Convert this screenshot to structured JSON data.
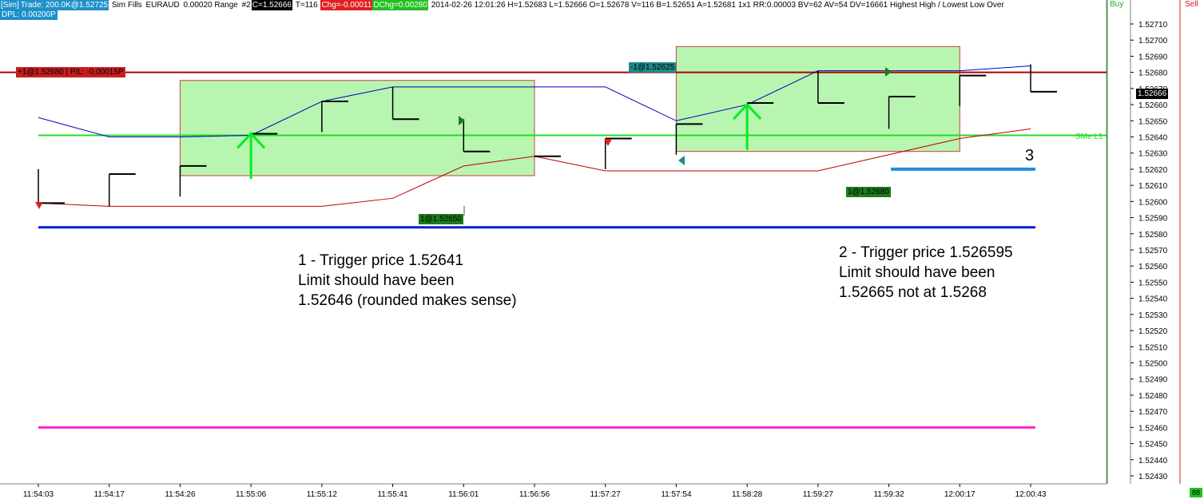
{
  "header": {
    "sim": "[Sim]",
    "trade": "Trade: 200.0K@1.52725",
    "fills": "Sim Fills",
    "symbol": "EURAUD",
    "range": "0.00020 Range",
    "num": "#2",
    "close": "C=1.52666",
    "ticks": "T=116",
    "chg": "Chg=-0.00011",
    "dchg": "DChg=0.00280",
    "stats": "2014-02-26 12:01:26 H=1.52683 L=1.52666 O=1.52678 V=116 B=1.52651 A=1.52681 1x1 RR:0.00003 BV=62 AV=54 DV=16661 Highest High / Lowest Low Over",
    "dpl": "DPL: 0.00200P"
  },
  "panels": {
    "buy": "Buy",
    "sell": "Sell",
    "corner": "88"
  },
  "colors": {
    "bars": "#000000",
    "upper_band": "#0000c0",
    "lower_band": "#c00000",
    "position_line": "#b00000",
    "trigger_line": "#22dd22",
    "blue_line": "#0020d0",
    "magenta_line": "#ff22cc",
    "short_blue": "#1e90dd",
    "box_fill": "#b8f5b0",
    "box_border": "#c84040"
  },
  "price_tags": {
    "position": "+1@1.52680 | P/L: -0.00015P",
    "sell_fill": "-1@1.52625",
    "buy_fill_1": "1@1.52650",
    "buy_fill_2": "1@1.52680",
    "current": "1.52666",
    "sme": "SMe L1"
  },
  "notes": {
    "n1_l1": "1 - Trigger price 1.52641",
    "n1_l2": "Limit should have been",
    "n1_l3": "1.52646 (rounded makes sense)",
    "n2_l1": "2 - Trigger price 1.526595",
    "n2_l2": "Limit should have been",
    "n2_l3": "1.52665 not at 1.5268",
    "n3": "3"
  },
  "chart_data": {
    "type": "line",
    "title": "",
    "xlabel": "",
    "ylabel": "",
    "categories": [
      "11:54:03",
      "11:54:17",
      "11:54:26",
      "11:55:06",
      "11:55:12",
      "11:55:41",
      "11:56:01",
      "11:56:56",
      "11:57:27",
      "11:57:54",
      "11:58:28",
      "11:59:27",
      "11:59:32",
      "12:00:17",
      "12:00:43"
    ],
    "ylim": [
      1.52425,
      1.52715
    ],
    "yticks": [
      1.5271,
      1.527,
      1.5269,
      1.5268,
      1.5267,
      1.5266,
      1.5265,
      1.5264,
      1.5263,
      1.5262,
      1.5261,
      1.526,
      1.5259,
      1.5258,
      1.5257,
      1.5256,
      1.5255,
      1.5254,
      1.5253,
      1.5252,
      1.5251,
      1.525,
      1.5249,
      1.5248,
      1.5247,
      1.5246,
      1.5245,
      1.5244,
      1.5243
    ],
    "bars": [
      {
        "o": 1.5262,
        "c": 1.52599,
        "h": 1.5262,
        "l": 1.52597
      },
      {
        "o": 1.52597,
        "c": 1.52617,
        "h": 1.52617,
        "l": 1.52597
      },
      {
        "o": 1.52603,
        "c": 1.52622,
        "h": 1.52622,
        "l": 1.52603
      },
      {
        "o": 1.5264,
        "c": 1.52642,
        "h": 1.52642,
        "l": 1.5264
      },
      {
        "o": 1.52643,
        "c": 1.52662,
        "h": 1.52662,
        "l": 1.52643
      },
      {
        "o": 1.52671,
        "c": 1.52651,
        "h": 1.52671,
        "l": 1.52651
      },
      {
        "o": 1.52651,
        "c": 1.52631,
        "h": 1.52651,
        "l": 1.52631
      },
      {
        "o": 1.52628,
        "c": 1.52628,
        "h": 1.52628,
        "l": 1.52628
      },
      {
        "o": 1.5262,
        "c": 1.52639,
        "h": 1.52639,
        "l": 1.5262
      },
      {
        "o": 1.52629,
        "c": 1.52648,
        "h": 1.52648,
        "l": 1.52629
      },
      {
        "o": 1.52642,
        "c": 1.52661,
        "h": 1.52661,
        "l": 1.52642
      },
      {
        "o": 1.52681,
        "c": 1.52661,
        "h": 1.52681,
        "l": 1.52661
      },
      {
        "o": 1.52645,
        "c": 1.52665,
        "h": 1.52665,
        "l": 1.52645
      },
      {
        "o": 1.52659,
        "c": 1.52678,
        "h": 1.52678,
        "l": 1.52659
      },
      {
        "o": 1.52685,
        "c": 1.52668,
        "h": 1.52685,
        "l": 1.52668
      }
    ],
    "series": [
      {
        "name": "",
        "values": [
          1.52652,
          1.5264,
          1.5264,
          1.52641,
          1.52662,
          1.52671,
          1.52671,
          1.52671,
          1.52671,
          1.5265,
          1.5266,
          1.52681,
          1.52681,
          1.52681,
          1.52684
        ]
      },
      {
        "name": "",
        "values": [
          1.52599,
          1.52597,
          1.52597,
          1.52597,
          1.52597,
          1.52602,
          1.52622,
          1.52628,
          1.52619,
          1.52619,
          1.52619,
          1.52619,
          1.52629,
          1.52639,
          1.52645
        ]
      }
    ],
    "hlines": {
      "position": 1.5268,
      "trigger": 1.52641,
      "blue": 1.52584,
      "short_blue": 1.5262,
      "magenta": 1.5246
    },
    "boxes": [
      {
        "from": "11:54:26",
        "to": "11:56:56",
        "top": 1.52675,
        "bottom": 1.52616
      },
      {
        "from": "11:57:54",
        "to": "12:00:17",
        "top": 1.52696,
        "bottom": 1.52631
      }
    ],
    "arrows": [
      {
        "at": "11:55:06",
        "low": 1.52614,
        "high": 1.52642
      },
      {
        "at": "11:58:28",
        "low": 1.52632,
        "high": 1.5266
      }
    ]
  }
}
